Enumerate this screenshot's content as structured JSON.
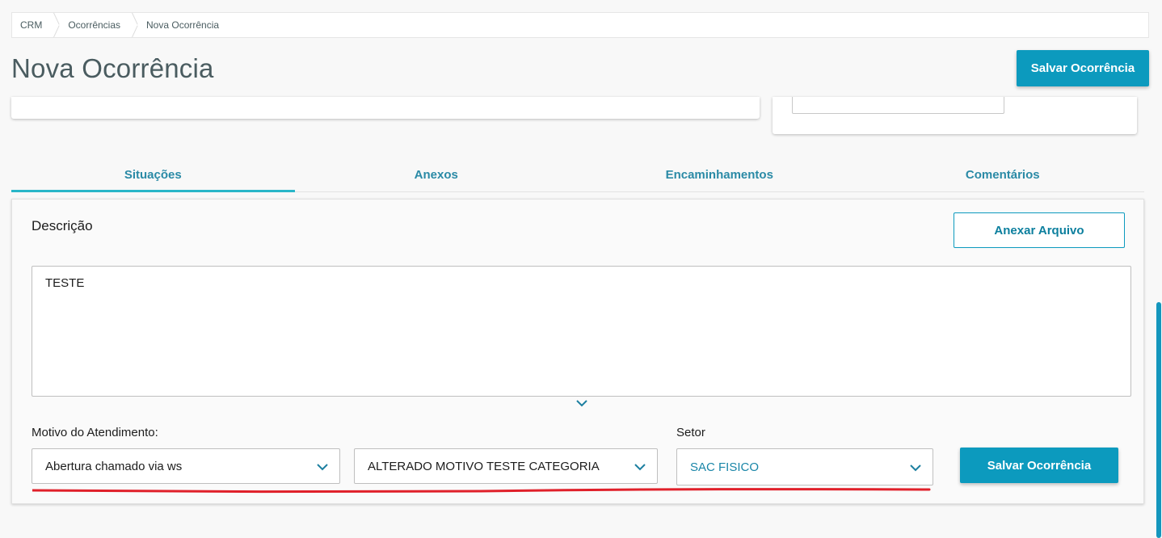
{
  "breadcrumb": [
    "CRM",
    "Ocorrências",
    "Nova Ocorrência"
  ],
  "header": {
    "title": "Nova Ocorrência",
    "save_label": "Salvar Ocorrência"
  },
  "tabs": [
    {
      "label": "Situações",
      "active": true
    },
    {
      "label": "Anexos",
      "active": false
    },
    {
      "label": "Encaminhamentos",
      "active": false
    },
    {
      "label": "Comentários",
      "active": false
    }
  ],
  "situacoes": {
    "description_label": "Descrição",
    "attach_label": "Anexar Arquivo",
    "description_value": "TESTE",
    "motivo_label": "Motivo do Atendimento:",
    "motivo_value": "Abertura chamado via ws",
    "submotivo_value": "ALTERADO MOTIVO TESTE CATEGORIA",
    "setor_label": "Setor",
    "setor_value": "SAC FISICO",
    "save_label": "Salvar Ocorrência"
  },
  "colors": {
    "primary": "#0c9abe",
    "tab_text": "#2a8aa6",
    "tab_active_bar": "#29b6c8",
    "annotation": "#e0202a"
  },
  "icons": [
    "chevron-down-icon",
    "expand-chevron-icon"
  ]
}
